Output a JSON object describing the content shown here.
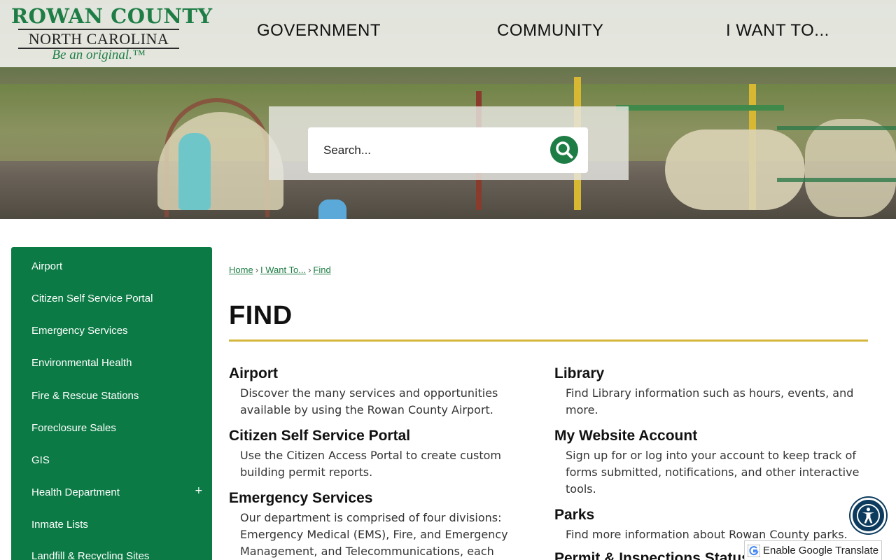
{
  "logo": {
    "line1": "ROWAN COUNTY",
    "line2": "NORTH CAROLINA",
    "line3": "Be an original.™"
  },
  "nav": {
    "items": [
      {
        "label": "GOVERNMENT"
      },
      {
        "label": "COMMUNITY"
      },
      {
        "label": "I WANT TO..."
      }
    ]
  },
  "search": {
    "placeholder": "Search...",
    "icon": "search-icon"
  },
  "sidebar": {
    "items": [
      {
        "label": "Airport"
      },
      {
        "label": "Citizen Self Service Portal"
      },
      {
        "label": "Emergency Services"
      },
      {
        "label": "Environmental Health"
      },
      {
        "label": "Fire & Rescue Stations"
      },
      {
        "label": "Foreclosure Sales"
      },
      {
        "label": "GIS"
      },
      {
        "label": "Health Department"
      },
      {
        "label": "Inmate Lists"
      },
      {
        "label": "Landfill & Recycling Sites"
      }
    ],
    "expand_symbol": "+"
  },
  "breadcrumb": {
    "items": [
      "Home",
      "I Want To...",
      "Find"
    ],
    "separator": "›"
  },
  "page": {
    "title": "FIND"
  },
  "entries_left": [
    {
      "title": "Airport",
      "desc": "Discover the many services and opportunities available by using the Rowan County Airport."
    },
    {
      "title": "Citizen Self Service Portal",
      "desc": "Use the Citizen Access Portal to create custom building permit reports."
    },
    {
      "title": "Emergency Services",
      "desc": "Our department is comprised of four divisions: Emergency Medical (EMS), Fire, and Emergency Management, and Telecommunications, each providing"
    }
  ],
  "entries_right": [
    {
      "title": "Library",
      "desc": "Find Library information such as hours, events, and more."
    },
    {
      "title": "My Website Account",
      "desc": "Sign up for or log into your account to keep track of forms submitted, notifications, and other interactive tools."
    },
    {
      "title": "Parks",
      "desc": "Find more information about Rowan County parks."
    },
    {
      "title": "Permit & Inspections Status",
      "desc": ""
    }
  ],
  "translate": {
    "label": "Enable Google Translate"
  },
  "colors": {
    "brand_green": "#1e7d45",
    "sidebar_green": "#0b7a45",
    "gold_rule": "#d4b63c",
    "a11y_navy": "#0c3b5e"
  }
}
